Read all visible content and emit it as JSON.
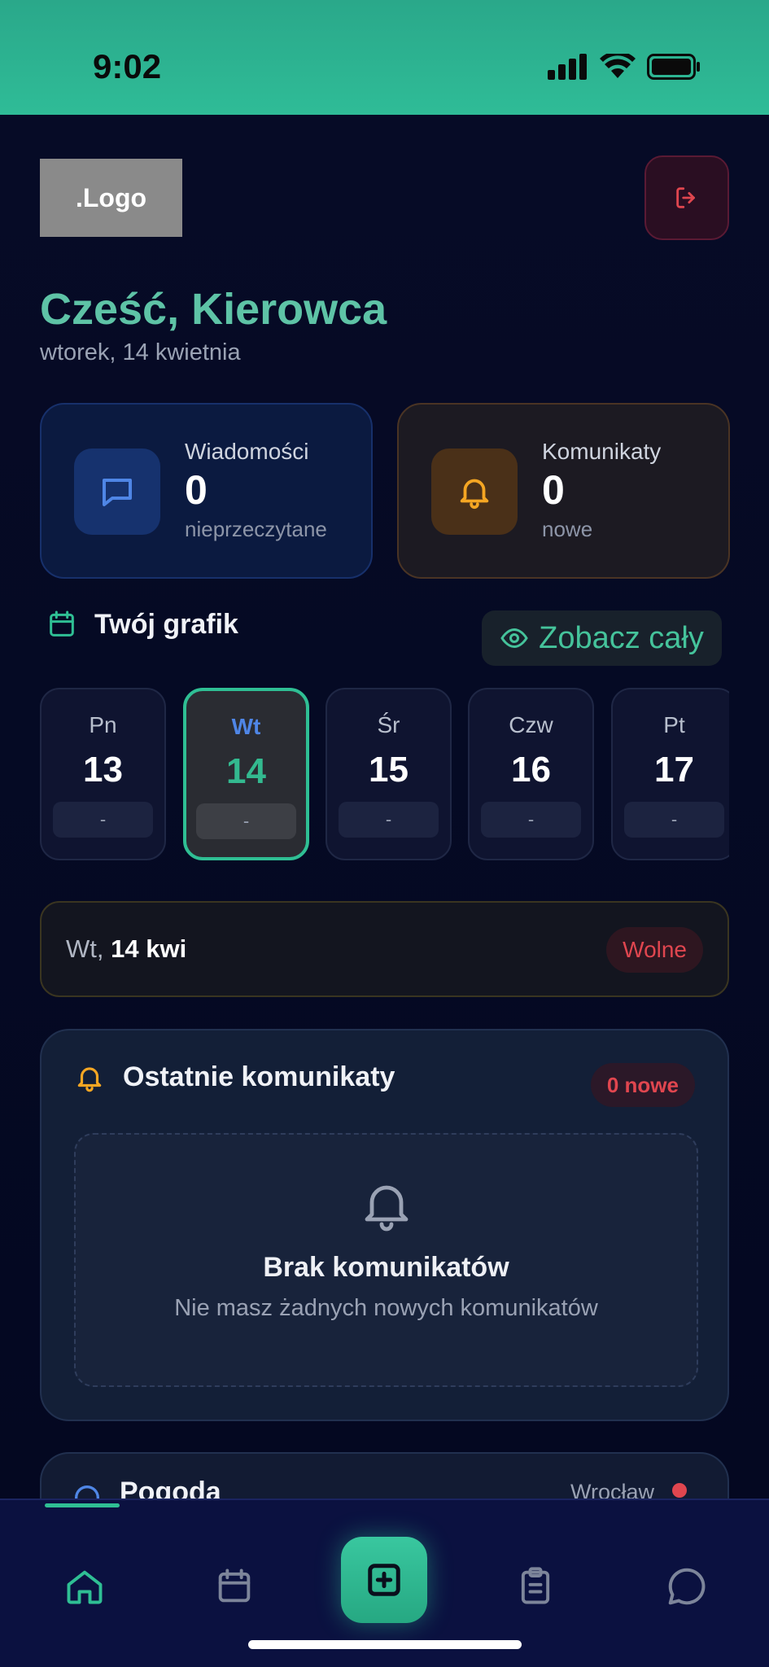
{
  "status_bar": {
    "time": "9:02"
  },
  "header": {
    "logo_text": ".Logo"
  },
  "greeting": {
    "title": "Cześć, Kierowca",
    "date": "wtorek, 14 kwietnia"
  },
  "stats": {
    "messages": {
      "label": "Wiadomości",
      "value": "0",
      "sub": "nieprzeczytane"
    },
    "announcements": {
      "label": "Komunikaty",
      "value": "0",
      "sub": "nowe"
    }
  },
  "schedule": {
    "title": "Twój grafik",
    "see_all": "Zobacz cały",
    "days": [
      {
        "name": "Pn",
        "num": "13",
        "slot": "-"
      },
      {
        "name": "Wt",
        "num": "14",
        "slot": "-"
      },
      {
        "name": "Śr",
        "num": "15",
        "slot": "-"
      },
      {
        "name": "Czw",
        "num": "16",
        "slot": "-"
      },
      {
        "name": "Pt",
        "num": "17",
        "slot": "-"
      }
    ],
    "selected_prefix": "Wt,",
    "selected_date": "14 kwi",
    "selected_status": "Wolne"
  },
  "announcements": {
    "title": "Ostatnie komunikaty",
    "badge": "0 nowe",
    "empty_title": "Brak komunikatów",
    "empty_sub": "Nie masz żadnych nowych komunikatów"
  },
  "weather": {
    "title": "Pogoda",
    "city": "Wrocław"
  },
  "icons": {
    "logout": "logout-icon",
    "messages": "chat-bubble-icon",
    "announcements": "bell-icon",
    "schedule": "calendar-icon",
    "see_all": "eye-icon",
    "nav_home": "home-icon",
    "nav_calendar": "calendar-icon",
    "nav_add": "plus-square-icon",
    "nav_tasks": "clipboard-icon",
    "nav_chat": "chat-icon"
  },
  "colors": {
    "accent": "#2fbf94",
    "danger": "#e0464f",
    "warning": "#f5a623",
    "primary_blue": "#4f86e6"
  }
}
